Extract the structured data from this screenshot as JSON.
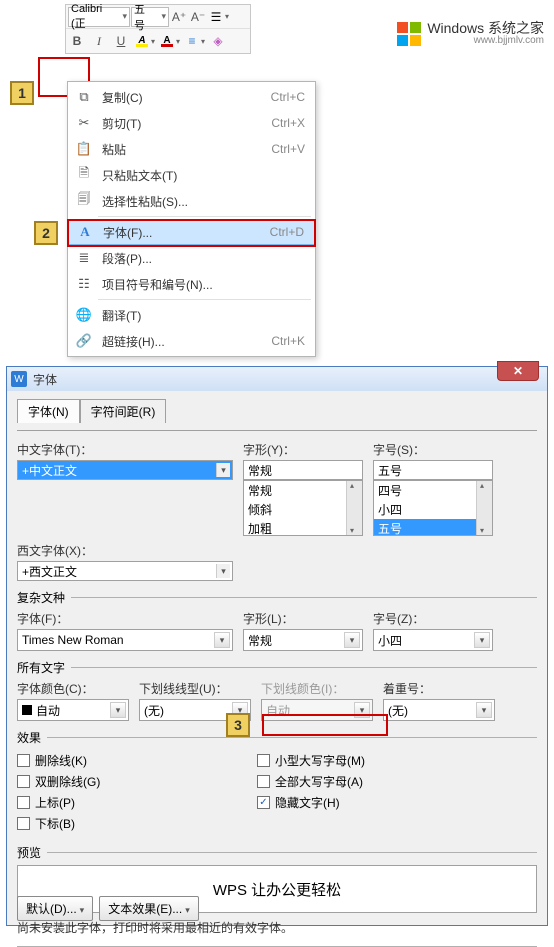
{
  "toolbar": {
    "font_name": "Calibri (正",
    "font_size": "五号",
    "btn_Aplus": "A⁺",
    "btn_Aminus": "A⁻",
    "btn_bold": "B",
    "btn_italic": "I",
    "btn_underline": "U",
    "btn_highlight": "A",
    "btn_fontcolor": "A",
    "btn_align": "≡",
    "btn_eraser": "◈"
  },
  "callouts": {
    "n1": "1",
    "n2": "2",
    "n3": "3"
  },
  "ctx": {
    "copy": {
      "label": "复制(C)",
      "shortcut": "Ctrl+C"
    },
    "cut": {
      "label": "剪切(T)",
      "shortcut": "Ctrl+X"
    },
    "paste": {
      "label": "粘贴",
      "shortcut": "Ctrl+V"
    },
    "paste_text": {
      "label": "只粘贴文本(T)"
    },
    "paste_special": {
      "label": "选择性粘贴(S)..."
    },
    "font": {
      "label": "字体(F)...",
      "shortcut": "Ctrl+D"
    },
    "para": {
      "label": "段落(P)..."
    },
    "bullets": {
      "label": "项目符号和编号(N)..."
    },
    "translate": {
      "label": "翻译(T)"
    },
    "hyperlink": {
      "label": "超链接(H)...",
      "shortcut": "Ctrl+K"
    }
  },
  "dialog": {
    "title": "字体",
    "tabs": {
      "font": "字体(N)",
      "spacing": "字符间距(R)"
    },
    "cn_font_label": "中文字体(T)：",
    "cn_font_value": "+中文正文",
    "style_label": "字形(Y)：",
    "style_value": "常规",
    "style_options": [
      "常规",
      "倾斜",
      "加粗"
    ],
    "size_label": "字号(S)：",
    "size_value": "五号",
    "size_options": [
      "四号",
      "小四",
      "五号"
    ],
    "en_font_label": "西文字体(X)：",
    "en_font_value": "+西文正文",
    "complex_group": "复杂文种",
    "complex_font_label": "字体(F)：",
    "complex_font_value": "Times New Roman",
    "complex_style_label": "字形(L)：",
    "complex_style_value": "常规",
    "complex_size_label": "字号(Z)：",
    "complex_size_value": "小四",
    "alltext_group": "所有文字",
    "fontcolor_label": "字体颜色(C)：",
    "fontcolor_value": "自动",
    "underlinestyle_label": "下划线线型(U)：",
    "underlinestyle_value": "(无)",
    "underlinecolor_label": "下划线颜色(I)：",
    "underlinecolor_value": "自动",
    "emphasis_label": "着重号：",
    "emphasis_value": "(无)",
    "effects_group": "效果",
    "chk_strike": "删除线(K)",
    "chk_dstrike": "双删除线(G)",
    "chk_super": "上标(P)",
    "chk_sub": "下标(B)",
    "chk_smallcaps": "小型大写字母(M)",
    "chk_allcaps": "全部大写字母(A)",
    "chk_hidden": "隐藏文字(H)",
    "preview_group": "预览",
    "preview_text": "WPS 让办公更轻松",
    "note": "尚未安装此字体，打印时将采用最相近的有效字体。",
    "btn_default": "默认(D)...",
    "btn_texteffect": "文本效果(E)..."
  },
  "watermark": {
    "brand": "Windows 系统之家",
    "url": "www.bjjmlv.com"
  }
}
